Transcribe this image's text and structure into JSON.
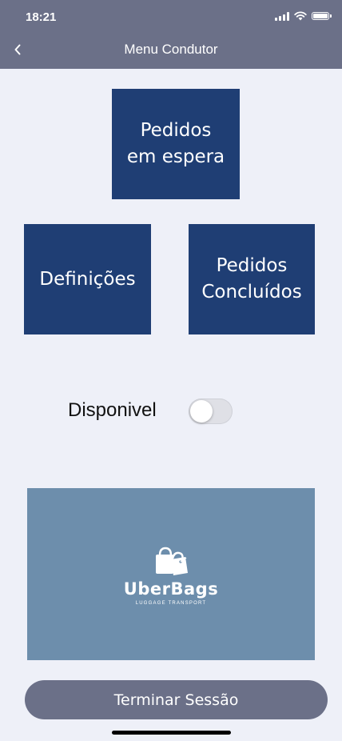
{
  "status_bar": {
    "time": "18:21",
    "icons": [
      "signal-icon",
      "wifi-icon",
      "battery-icon"
    ]
  },
  "header": {
    "back_icon": "chevron-left-icon",
    "title": "Menu Condutor"
  },
  "tiles": {
    "pending": "Pedidos\nem espera",
    "settings": "Definições",
    "completed": "Pedidos\nConcluídos"
  },
  "availability": {
    "label": "Disponivel",
    "enabled": false
  },
  "logo": {
    "name": "UberBags",
    "tagline": "LUGGAGE TRANSPORT"
  },
  "logout": {
    "label": "Terminar Sessão"
  },
  "colors": {
    "header_bg": "#6b7088",
    "tile_bg": "#1f3e74",
    "page_bg": "#eef0f8",
    "logo_bg": "#6d8eac"
  }
}
